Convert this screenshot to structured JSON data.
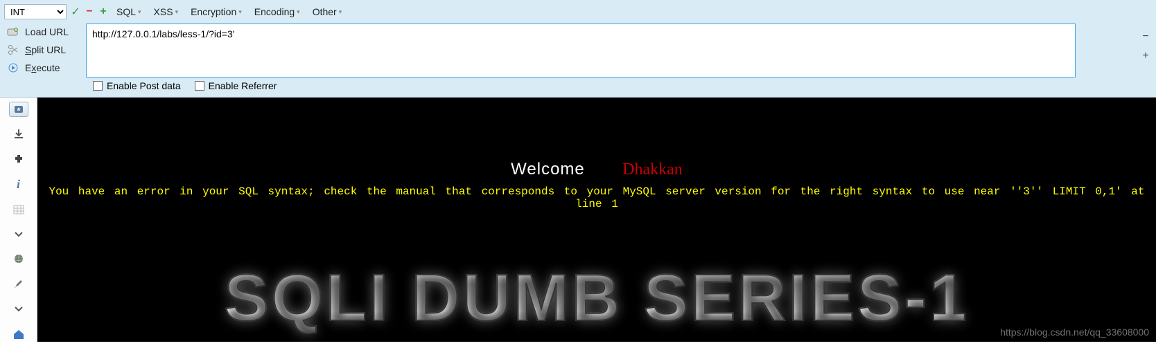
{
  "toolbar": {
    "type_select": "INT",
    "menus": {
      "sql": "SQL",
      "xss": "XSS",
      "encryption": "Encryption",
      "encoding": "Encoding",
      "other": "Other"
    }
  },
  "side_actions": {
    "load_url": "Load URL",
    "split_url": "Split URL",
    "execute": "Execute"
  },
  "url": "http://127.0.0.1/labs/less-1/?id=3'",
  "checks": {
    "enable_post": "Enable Post data",
    "enable_referrer": "Enable Referrer"
  },
  "page": {
    "welcome": "Welcome",
    "name": "Dhakkan",
    "error": "You have an error in your SQL syntax; check the manual that corresponds to your MySQL server version for the right syntax to use near ''3'' LIMIT 0,1' at line 1",
    "banner": "SQLI DUMB SERIES-1"
  },
  "watermark": "https://blog.csdn.net/qq_33608000"
}
